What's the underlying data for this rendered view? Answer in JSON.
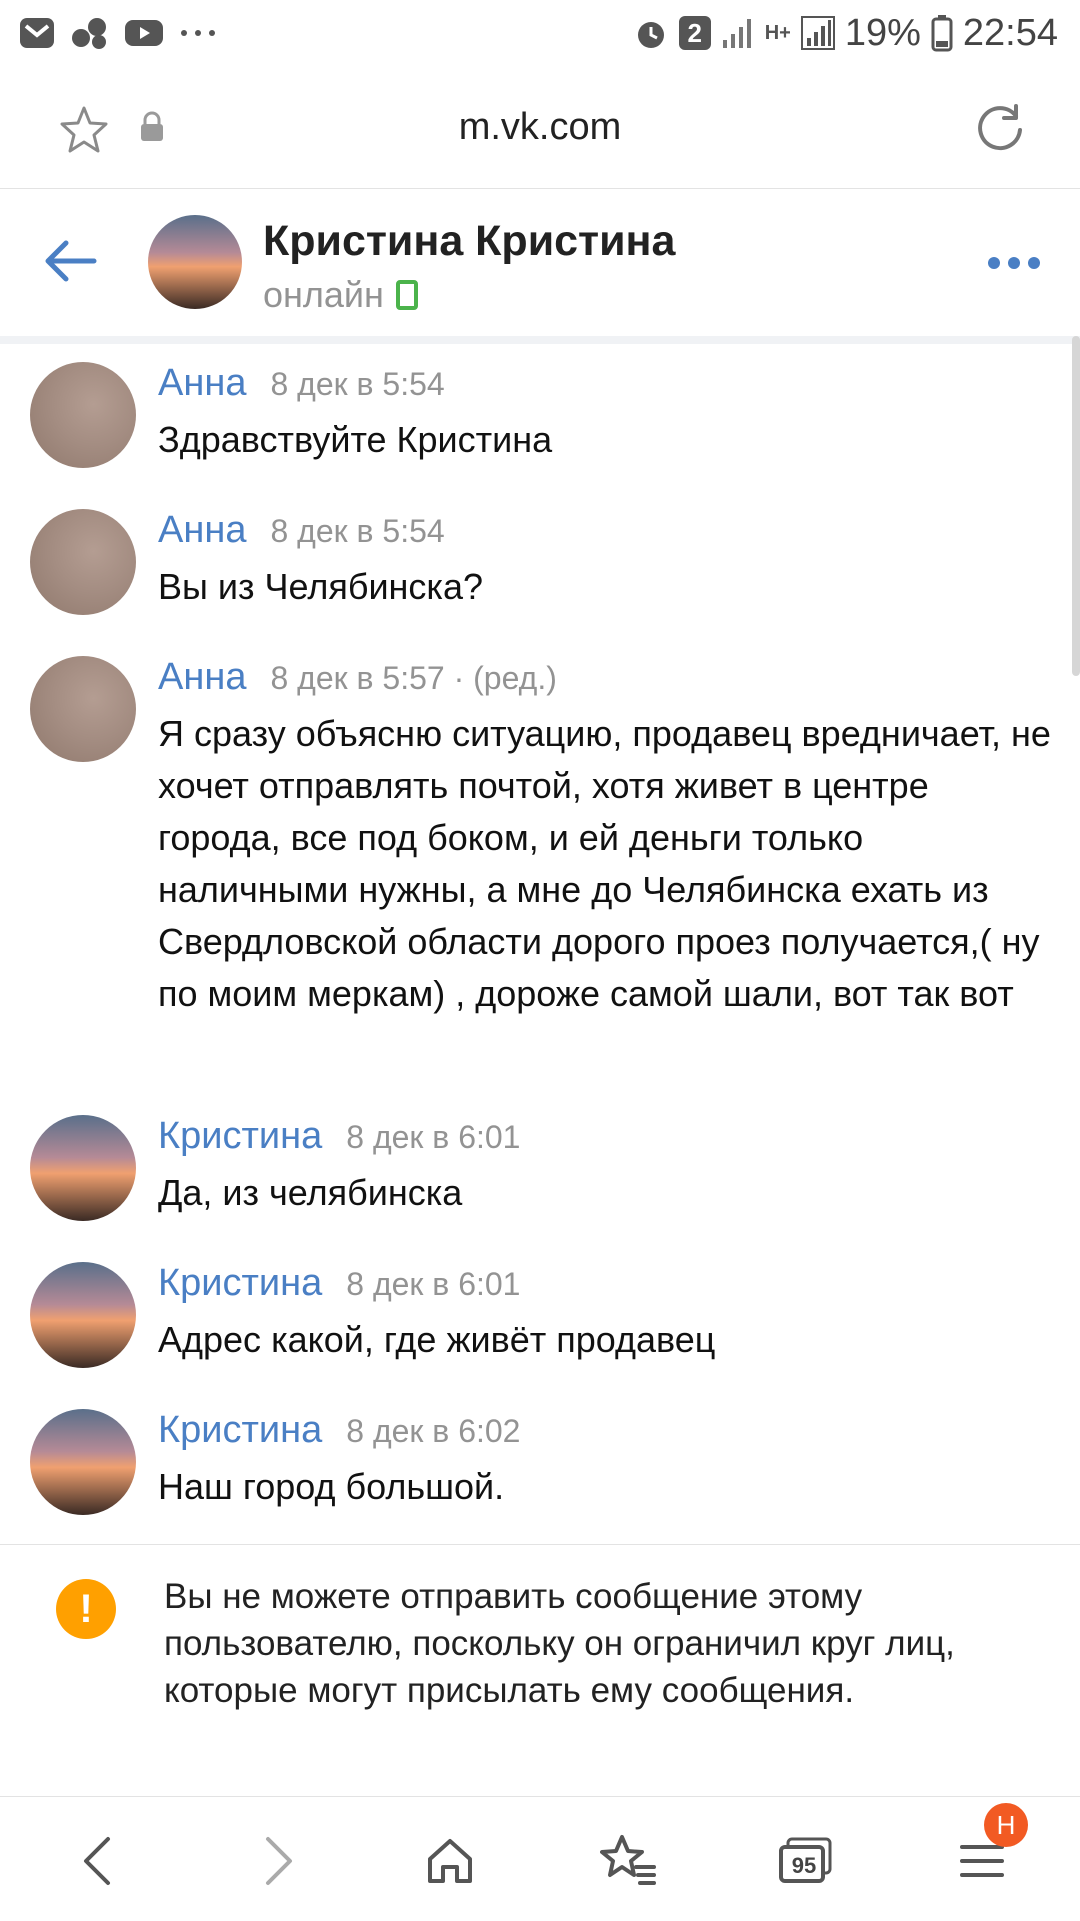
{
  "status_bar": {
    "left_icons": [
      "mail-icon",
      "cluster-icon",
      "youtube-icon",
      "more-dots-icon"
    ],
    "alarm_icon": "alarm-icon",
    "notification_count": "2",
    "network": "H+",
    "battery": "19%",
    "time": "22:54"
  },
  "browser": {
    "url": "m.vk.com"
  },
  "chat": {
    "name": "Кристина Кристина",
    "status": "онлайн"
  },
  "messages": [
    {
      "author": "Анна",
      "time": "8 дек в 5:54",
      "text": "Здравствуйте Кристина"
    },
    {
      "author": "Анна",
      "time": "8 дек в 5:54",
      "text": "Вы из Челябинска?"
    },
    {
      "author": "Анна",
      "time": "8 дек в 5:57 · (ред.)",
      "text": "Я сразу объясню ситуацию, продавец вредничает, не хочет отправлять почтой, хотя живет в центре города, все под боком, и ей деньги только наличными нужны, а мне до Челябинска ехать из Свердловской области дорого проез получается,( ну по моим меркам) , дороже самой шали, вот так вот"
    },
    {
      "author": "Кристина",
      "time": "8 дек в 6:01",
      "text": "Да, из челябинска"
    },
    {
      "author": "Кристина",
      "time": "8 дек в 6:01",
      "text": "Адрес какой, где живёт продавец"
    },
    {
      "author": "Кристина",
      "time": "8 дек в 6:02",
      "text": "Наш город большой."
    }
  ],
  "notice": {
    "icon": "!",
    "text": "Вы не можете отправить сообщение этому пользователю, поскольку он ограничил круг лиц, которые могут присылать ему сообщения."
  },
  "bottom_nav": {
    "tabs_count": "95",
    "menu_badge": "Н"
  }
}
